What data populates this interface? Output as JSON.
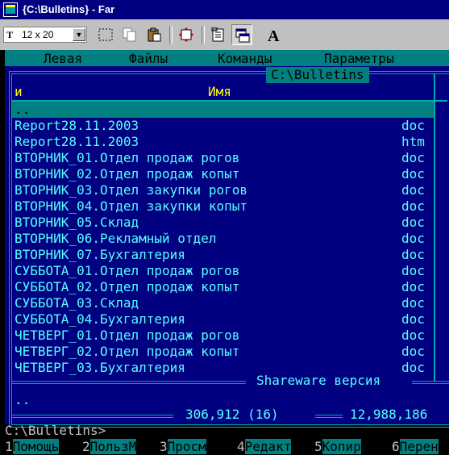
{
  "window": {
    "title": "{C:\\Bulletins} - Far"
  },
  "toolbar": {
    "font_select": "12 x 20",
    "font_icon": "T",
    "buttons": [
      "select-icon",
      "copy-icon",
      "paste-icon",
      "fullscreen-icon",
      "properties-icon",
      "background-icon",
      "font-icon"
    ]
  },
  "menu": [
    "Левая",
    "Файлы",
    "Команды",
    "Параметры"
  ],
  "panel": {
    "path": "C:\\Bulletins",
    "col_sort": "и",
    "col_name": "Имя",
    "cursor_item": "..",
    "files": [
      {
        "name": "Report28.11.2003",
        "ext": "doc"
      },
      {
        "name": "Report28.11.2003",
        "ext": "htm"
      },
      {
        "name": "ВТОРНИК_01.Отдел продаж рогов",
        "ext": "doc"
      },
      {
        "name": "ВТОРНИК_02.Отдел продаж копыт",
        "ext": "doc"
      },
      {
        "name": "ВТОРНИК_03.Отдел закупки рогов",
        "ext": "doc"
      },
      {
        "name": "ВТОРНИК_04.Отдел закупки копыт",
        "ext": "doc"
      },
      {
        "name": "ВТОРНИК_05.Склад",
        "ext": "doc"
      },
      {
        "name": "ВТОРНИК_06.Рекламный отдел",
        "ext": "doc"
      },
      {
        "name": "ВТОРНИК_07.Бухгалтерия",
        "ext": "doc"
      },
      {
        "name": "СУББОТА_01.Отдел продаж рогов",
        "ext": "doc"
      },
      {
        "name": "СУББОТА_02.Отдел продаж копыт",
        "ext": "doc"
      },
      {
        "name": "СУББОТА_03.Склад",
        "ext": "doc"
      },
      {
        "name": "СУББОТА_04.Бухгалтерия",
        "ext": "doc"
      },
      {
        "name": "ЧЕТВЕРГ_01.Отдел продаж рогов",
        "ext": "doc"
      },
      {
        "name": "ЧЕТВЕРГ_02.Отдел продаж копыт",
        "ext": "doc"
      },
      {
        "name": "ЧЕТВЕРГ_03.Бухгалтерия",
        "ext": "doc"
      }
    ],
    "version_label": "Shareware версия",
    "info_name": "..",
    "status_size": "306,912 (16)",
    "status_free": "12,988,186"
  },
  "command_line": "C:\\Bulletins>",
  "keybar": [
    {
      "num": "1",
      "label": "Помощь"
    },
    {
      "num": "2",
      "label": "ПользМ"
    },
    {
      "num": "3",
      "label": "Просм"
    },
    {
      "num": "4",
      "label": "Редакт"
    },
    {
      "num": "5",
      "label": "Копир"
    },
    {
      "num": "6",
      "label": "Перен"
    }
  ],
  "colors": {
    "panel_bg": "#000080",
    "text": "#55ffff",
    "highlight": "#008080",
    "header": "#ffff00"
  }
}
